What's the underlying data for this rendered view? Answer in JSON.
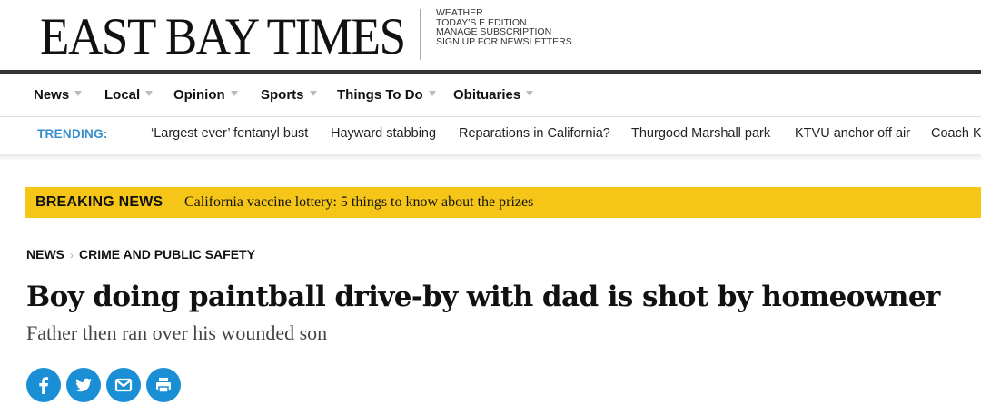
{
  "masthead": {
    "logo": "EAST BAY TIMES",
    "links": [
      "WEATHER",
      "TODAY'S E EDITION",
      "MANAGE SUBSCRIPTION",
      "SIGN UP FOR NEWSLETTERS"
    ]
  },
  "nav": {
    "items": [
      "News",
      "Local",
      "Opinion",
      "Sports",
      "Things To Do",
      "Obituaries"
    ]
  },
  "trending": {
    "label": "TRENDING:",
    "items": [
      "‘Largest ever’ fentanyl bust",
      "Hayward stabbing",
      "Reparations in California?",
      "Thurgood Marshall park",
      "KTVU anchor off air",
      "Coach K"
    ]
  },
  "breaking": {
    "label": "BREAKING NEWS",
    "text": "California vaccine lottery: 5 things to know about the prizes"
  },
  "breadcrumb": {
    "section": "NEWS",
    "subsection": "CRIME AND PUBLIC SAFETY"
  },
  "article": {
    "headline": "Boy doing paintball drive-by with dad is shot by homeowner",
    "subheadline": "Father then ran over his wounded son"
  },
  "share": {
    "icons": [
      "facebook-icon",
      "twitter-icon",
      "email-icon",
      "print-icon"
    ],
    "color": "#1a8fd6"
  },
  "colors": {
    "breaking_bg": "#f5c518",
    "trending_label": "#3a8fc9",
    "rule": "#333333"
  }
}
